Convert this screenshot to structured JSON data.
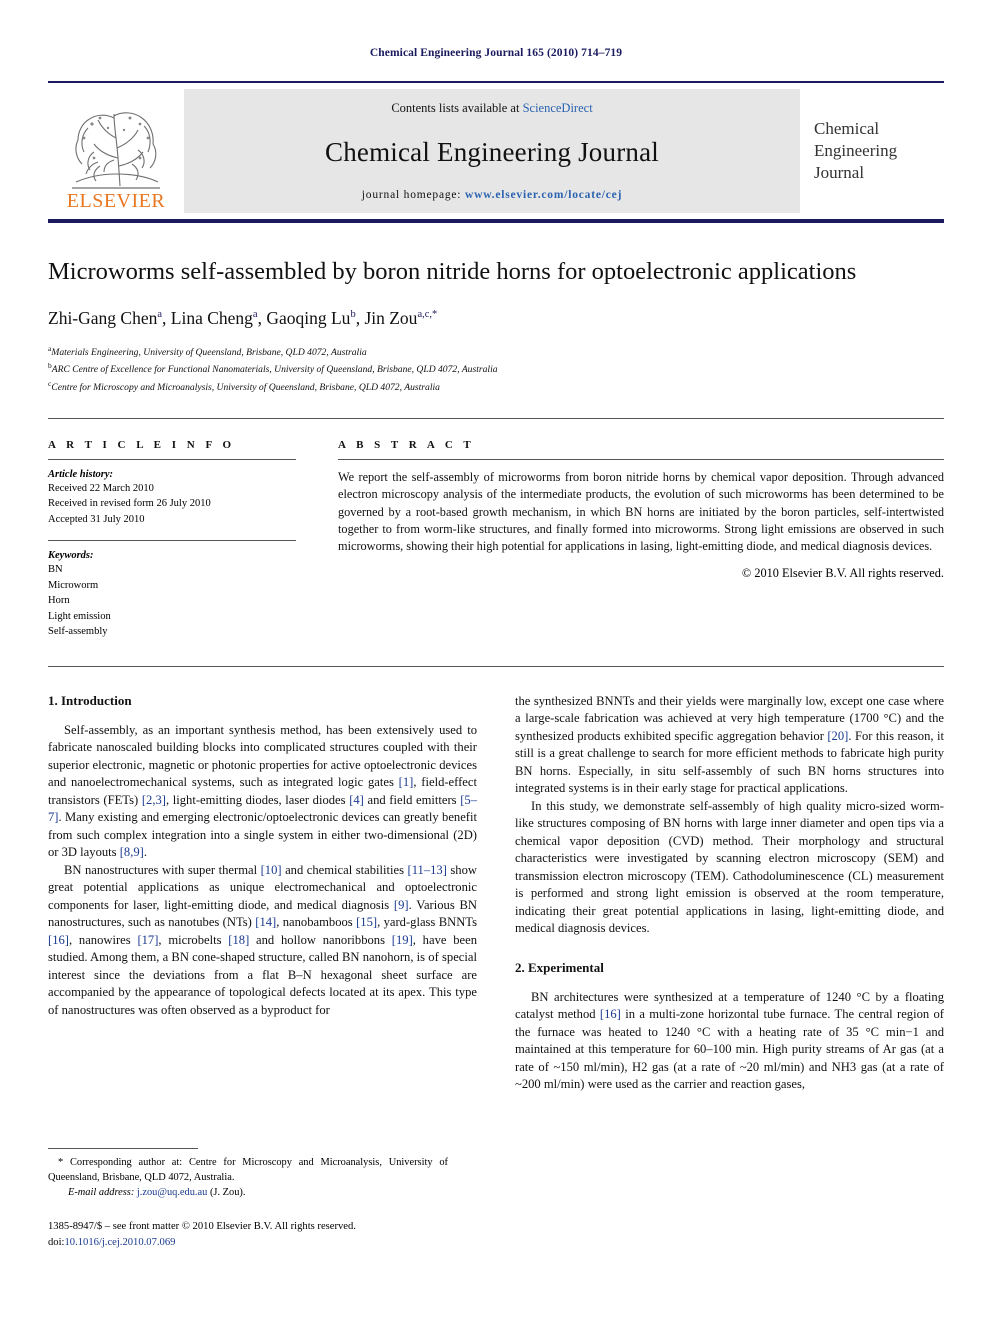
{
  "running_head": "Chemical Engineering Journal 165 (2010) 714–719",
  "masthead": {
    "publisher_logo_text": "ELSEVIER",
    "contents_prefix": "Contents lists available at ",
    "contents_link": "ScienceDirect",
    "journal_title": "Chemical Engineering Journal",
    "homepage_label": "journal homepage:",
    "homepage_url": "www.elsevier.com/locate/cej",
    "cover_lines": [
      "Chemical",
      "Engineering",
      "Journal"
    ],
    "link_color": "#2b63b0",
    "band_color": "#1a1a5e",
    "panel_color": "#e6e6e6",
    "logo_color": "#E87722"
  },
  "article": {
    "title": "Microworms self-assembled by boron nitride horns for optoelectronic applications",
    "authors": [
      {
        "name": "Zhi-Gang Chen",
        "sup": "a"
      },
      {
        "name": "Lina Cheng",
        "sup": "a"
      },
      {
        "name": "Gaoqing Lu",
        "sup": "b"
      },
      {
        "name": "Jin Zou",
        "sup": "a,c,*"
      }
    ],
    "affiliations": [
      {
        "mark": "a",
        "text": "Materials Engineering, University of Queensland, Brisbane, QLD 4072, Australia"
      },
      {
        "mark": "b",
        "text": "ARC Centre of Excellence for Functional Nanomaterials, University of Queensland, Brisbane, QLD 4072, Australia"
      },
      {
        "mark": "c",
        "text": "Centre for Microscopy and Microanalysis, University of Queensland, Brisbane, QLD 4072, Australia"
      }
    ]
  },
  "article_info": {
    "heading": "A R T I C L E    I N F O",
    "history_label": "Article history:",
    "history": [
      "Received 22 March 2010",
      "Received in revised form 26 July 2010",
      "Accepted 31 July 2010"
    ],
    "keywords_label": "Keywords:",
    "keywords": [
      "BN",
      "Microworm",
      "Horn",
      "Light emission",
      "Self-assembly"
    ]
  },
  "abstract": {
    "heading": "A B S T R A C T",
    "text": "We report the self-assembly of microworms from boron nitride horns by chemical vapor deposition. Through advanced electron microscopy analysis of the intermediate products, the evolution of such microworms has been determined to be governed by a root-based growth mechanism, in which BN horns are initiated by the boron particles, self-intertwisted together to from worm-like structures, and finally formed into microworms. Strong light emissions are observed in such microworms, showing their high potential for applications in lasing, light-emitting diode, and medical diagnosis devices.",
    "copyright": "© 2010 Elsevier B.V. All rights reserved."
  },
  "body": {
    "section1_heading": "1.  Introduction",
    "section1_p1": "Self-assembly, as an important synthesis method, has been extensively used to fabricate nanoscaled building blocks into complicated structures coupled with their superior electronic, magnetic or photonic properties for active optoelectronic devices and nanoelectromechanical systems, such as integrated logic gates [1], field-effect transistors (FETs) [2,3], light-emitting diodes, laser diodes [4] and field emitters [5–7]. Many existing and emerging electronic/optoelectronic devices can greatly benefit from such complex integration into a single system in either two-dimensional (2D) or 3D layouts [8,9].",
    "section1_p2": "BN nanostructures with super thermal [10] and chemical stabilities [11–13] show great potential applications as unique electromechanical and optoelectronic components for laser, light-emitting diode, and medical diagnosis [9]. Various BN nanostructures, such as nanotubes (NTs) [14], nanobamboos [15], yard-glass BNNTs [16], nanowires [17], microbelts [18] and hollow nanoribbons [19], have been studied. Among them, a BN cone-shaped structure, called BN nanohorn, is of special interest since the deviations from a flat B–N hexagonal sheet surface are accompanied by the appearance of topological defects located at its apex. This type of nanostructures was often observed as a byproduct for",
    "section1_p3": "the synthesized BNNTs and their yields were marginally low, except one case where a large-scale fabrication was achieved at very high temperature (1700 °C) and the synthesized products exhibited specific aggregation behavior [20]. For this reason, it still is a great challenge to search for more efficient methods to fabricate high purity BN horns. Especially, in situ self-assembly of such BN horns structures into integrated systems is in their early stage for practical applications.",
    "section1_p4": "In this study, we demonstrate self-assembly of high quality micro-sized worm-like structures composing of BN horns with large inner diameter and open tips via a chemical vapor deposition (CVD) method. Their morphology and structural characteristics were investigated by scanning electron microscopy (SEM) and transmission electron microscopy (TEM). Cathodoluminescence (CL) measurement is performed and strong light emission is observed at the room temperature, indicating their great potential applications in lasing, light-emitting diode, and medical diagnosis devices.",
    "section2_heading": "2.  Experimental",
    "section2_p1": "BN architectures were synthesized at a temperature of 1240 °C by a floating catalyst method [16] in a multi-zone horizontal tube furnace. The central region of the furnace was heated to 1240 °C with a heating rate of 35 °C min−1 and maintained at this temperature for 60–100 min. High purity streams of Ar gas (at a rate of ~150 ml/min), H2 gas (at a rate of ~20 ml/min) and NH3 gas (at a rate of ~200 ml/min) were used as the carrier and reaction gases,"
  },
  "footnote": {
    "corresponding": "* Corresponding author at: Centre for Microscopy and Microanalysis, University of Queensland, Brisbane, QLD 4072, Australia.",
    "email_label": "E-mail address:",
    "email": "j.zou@uq.edu.au",
    "email_suffix": "(J. Zou).",
    "issn_line": "1385-8947/$ – see front matter © 2010 Elsevier B.V. All rights reserved.",
    "doi_label": "doi:",
    "doi": "10.1016/j.cej.2010.07.069"
  }
}
